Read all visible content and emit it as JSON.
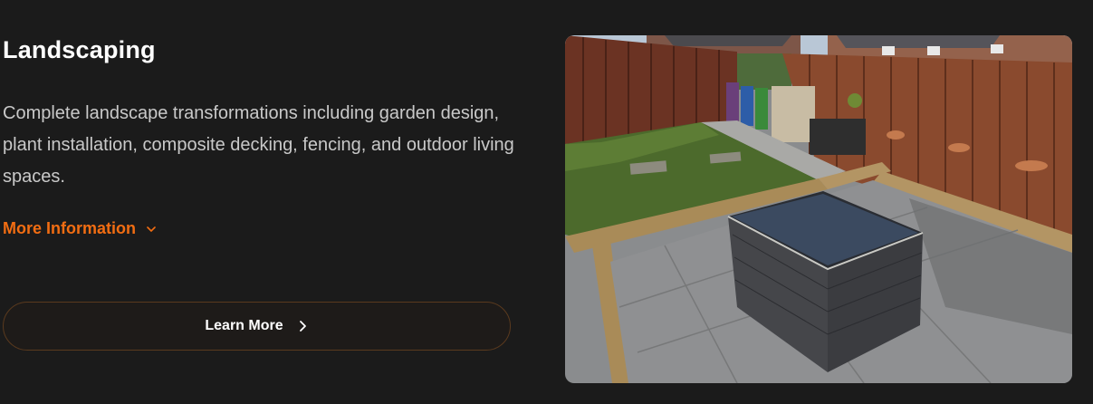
{
  "service": {
    "title": "Landscaping",
    "description": "Complete landscape transformations including garden design, plant installation, composite decking, fencing, and outdoor living spaces.",
    "more_info_label": "More Information",
    "learn_more_label": "Learn More"
  },
  "icons": {
    "more_info": "chevron-down-icon",
    "learn_more": "chevron-right-icon"
  },
  "colors": {
    "background": "#1b1b1b",
    "accent": "#f26d12",
    "button_border": "#5a3a1e",
    "text_primary": "#ffffff",
    "text_secondary": "#c9c9c9"
  }
}
